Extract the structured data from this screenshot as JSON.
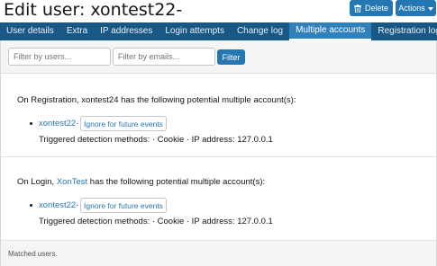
{
  "header": {
    "title": "Edit user: xontest22-",
    "delete_label": "Delete",
    "actions_label": "Actions"
  },
  "tabs": [
    {
      "label": "User details",
      "active": false
    },
    {
      "label": "Extra",
      "active": false
    },
    {
      "label": "IP addresses",
      "active": false
    },
    {
      "label": "Login attempts",
      "active": false
    },
    {
      "label": "Change log",
      "active": false
    },
    {
      "label": "Multiple accounts",
      "active": true
    },
    {
      "label": "Registration log",
      "active": false
    }
  ],
  "filters": {
    "users_placeholder": "Filter by users...",
    "emails_placeholder": "Filter by emails...",
    "filter_button": "Filter"
  },
  "entries": [
    {
      "prefix": "On Registration, ",
      "user": "xontest24",
      "user_is_link": false,
      "suffix": " has the following potential multiple account(s):",
      "account": "xontest22-",
      "ignore_label": "Ignore for future events",
      "methods": "Triggered detection methods: · Cookie · IP address: 127.0.0.1"
    },
    {
      "prefix": "On Login, ",
      "user": "XonTest",
      "user_is_link": true,
      "suffix": " has the following potential multiple account(s):",
      "account": "xontest22-",
      "ignore_label": "Ignore for future events",
      "methods": "Triggered detection methods: · Cookie · IP address: 127.0.0.1"
    }
  ],
  "footer": {
    "text": "Matched users."
  },
  "colors": {
    "primary": "#2577b1",
    "tabbar": "#185886",
    "link": "#2577b1"
  }
}
